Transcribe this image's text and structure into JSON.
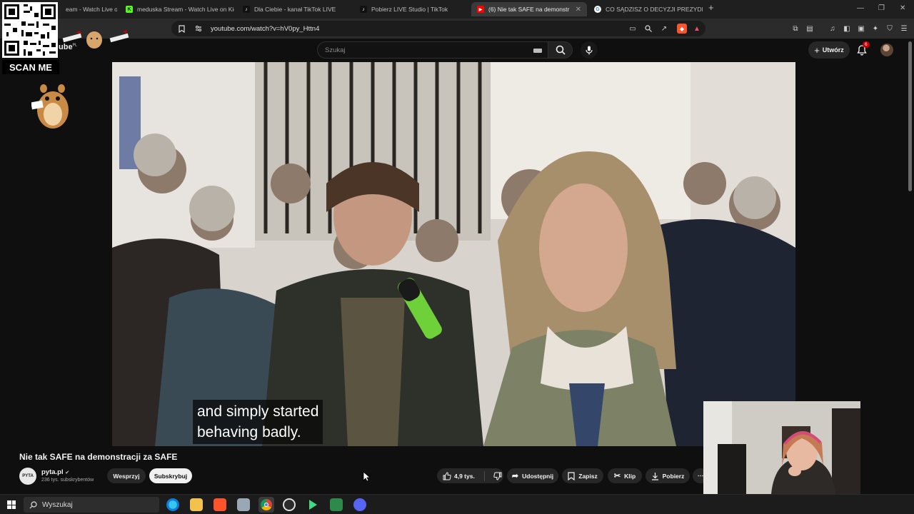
{
  "browser": {
    "tabs": [
      {
        "title": "eam - Watch Live on",
        "favicon": "kick-icon"
      },
      {
        "title": "meduska Stream - Watch Live on Kic",
        "favicon": "kick-icon"
      },
      {
        "title": "Dla Ciebie - kanał TikTok LIVE",
        "favicon": "tiktok-icon"
      },
      {
        "title": "Pobierz LIVE Studio | TikTok",
        "favicon": "tiktok-icon"
      },
      {
        "title": "(6) Nie tak SAFE na demonstr",
        "favicon": "youtube-icon",
        "active": true
      },
      {
        "title": "CO SĄDZISZ O DECYZJI PREZYDENTA",
        "favicon": "google-icon"
      }
    ],
    "new_tab": "+",
    "url": "youtube.com/watch?v=hV0py_Httn4"
  },
  "youtube": {
    "logo_text": "ube",
    "logo_region": "PL",
    "search_placeholder": "Szukaj",
    "create_label": "Utwórz",
    "notification_count": "6"
  },
  "overlay": {
    "scan_me": "SCAN ME"
  },
  "video": {
    "caption_line1": "and simply started",
    "caption_line2": "behaving badly.",
    "title": "Nie tak SAFE na demonstracji za SAFE"
  },
  "channel": {
    "name": "pyta.pl",
    "subscribers": "236 tys. subskrybentów",
    "support_label": "Wesprzyj",
    "subscribe_label": "Subskrybuj"
  },
  "actions": {
    "likes": "4,9 tys.",
    "share": "Udostępnij",
    "save": "Zapisz",
    "clip": "Klip",
    "download": "Pobierz",
    "more": "⋯"
  },
  "taskbar": {
    "search_label": "Wyszukaj"
  },
  "colors": {
    "bg": "#0f0f0f",
    "pill_dark": "#272727",
    "subscribe_bg": "#f1f1f1",
    "badge_red": "#cc0000"
  }
}
